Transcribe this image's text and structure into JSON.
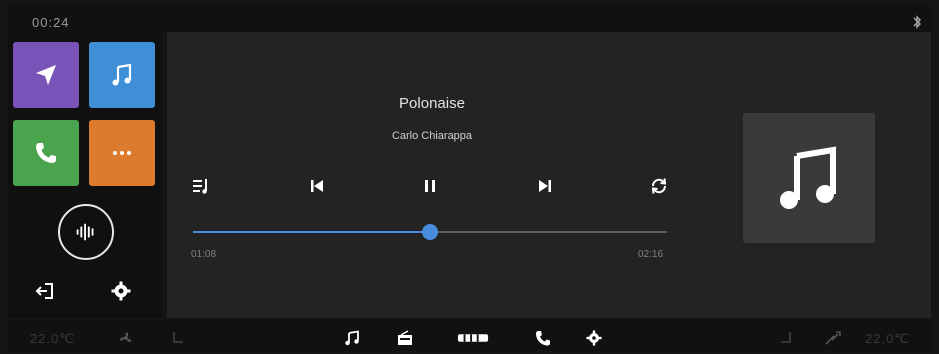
{
  "status_bar": {
    "time": "00:24",
    "bluetooth_icon": "bluetooth-icon"
  },
  "apps": [
    {
      "name": "navigation",
      "icon": "navigation-arrow-icon",
      "color": "#7a53b8"
    },
    {
      "name": "music",
      "icon": "music-note-icon",
      "color": "#3f8fd6"
    },
    {
      "name": "phone",
      "icon": "phone-icon",
      "color": "#4aa34d"
    },
    {
      "name": "more",
      "icon": "more-dots-icon",
      "color": "#dc7a2d"
    }
  ],
  "player": {
    "title": "Polonaise",
    "artist": "Carlo Chiarappa",
    "elapsed": "01:08",
    "total": "02:16",
    "progress_fraction": 0.5,
    "accent_color": "#4a8de0"
  },
  "bottom_bar": {
    "temp_left": "22.0℃",
    "temp_right": "22.0℃",
    "icons": [
      "fan-icon",
      "seat-heat-icon",
      "music-note-icon",
      "radio-icon",
      "media-bar-icon",
      "phone-icon",
      "settings-icon",
      "seat-heat-icon",
      "climate-icon"
    ]
  }
}
